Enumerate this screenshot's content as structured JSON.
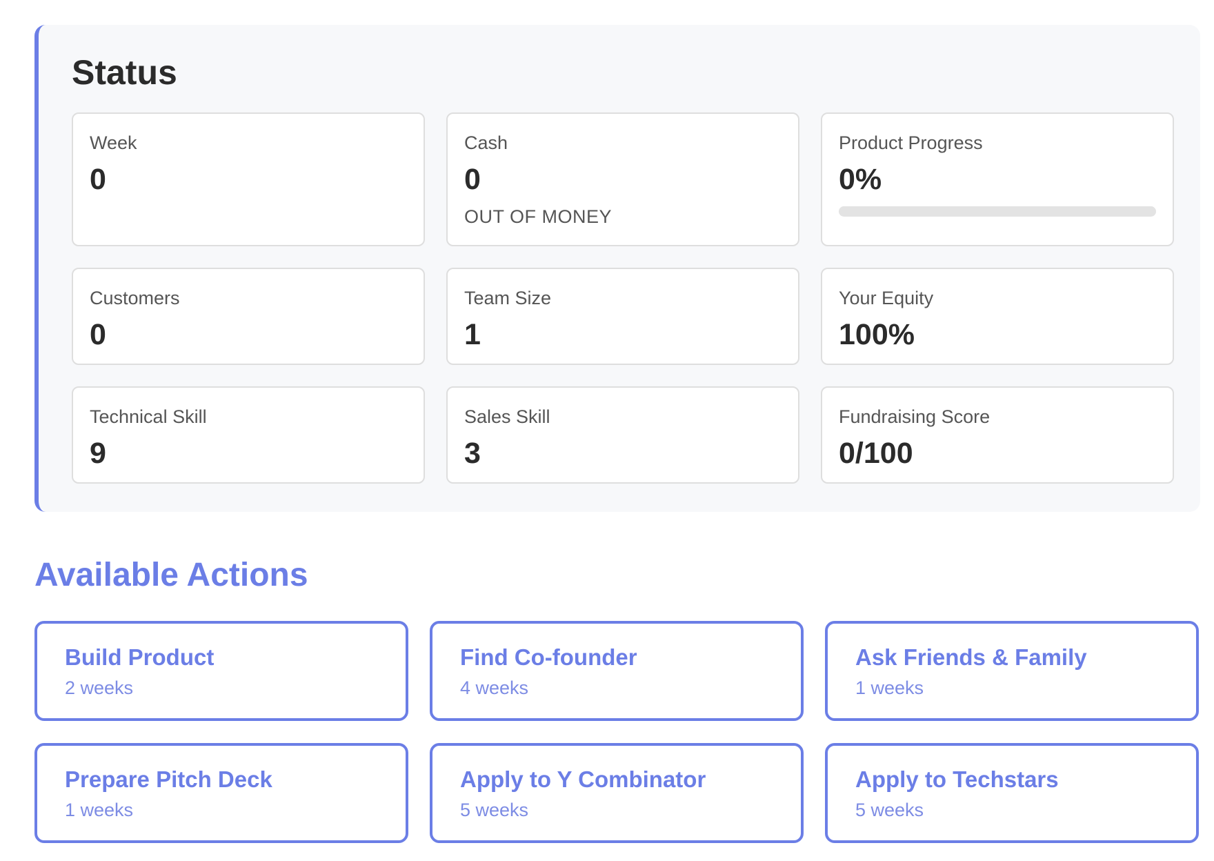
{
  "status": {
    "title": "Status",
    "cards": [
      {
        "label": "Week",
        "value": "0"
      },
      {
        "label": "Cash",
        "value": "0",
        "note": "OUT OF MONEY"
      },
      {
        "label": "Product Progress",
        "value": "0%",
        "progress_fraction": 0
      },
      {
        "label": "Customers",
        "value": "0"
      },
      {
        "label": "Team Size",
        "value": "1"
      },
      {
        "label": "Your Equity",
        "value": "100%"
      },
      {
        "label": "Technical Skill",
        "value": "9"
      },
      {
        "label": "Sales Skill",
        "value": "3"
      },
      {
        "label": "Fundraising Score",
        "value": "0/100"
      }
    ]
  },
  "actions": {
    "title": "Available Actions",
    "items": [
      {
        "name": "Build Product",
        "duration": "2 weeks"
      },
      {
        "name": "Find Co-founder",
        "duration": "4 weeks"
      },
      {
        "name": "Ask Friends & Family",
        "duration": "1 weeks"
      },
      {
        "name": "Prepare Pitch Deck",
        "duration": "1 weeks"
      },
      {
        "name": "Apply to Y Combinator",
        "duration": "5 weeks"
      },
      {
        "name": "Apply to Techstars",
        "duration": "5 weeks"
      }
    ]
  },
  "colors": {
    "accent": "#6b7ee6",
    "panel_bg": "#f7f8fa",
    "card_border": "#dedede",
    "progress_track": "#e3e3e3"
  }
}
